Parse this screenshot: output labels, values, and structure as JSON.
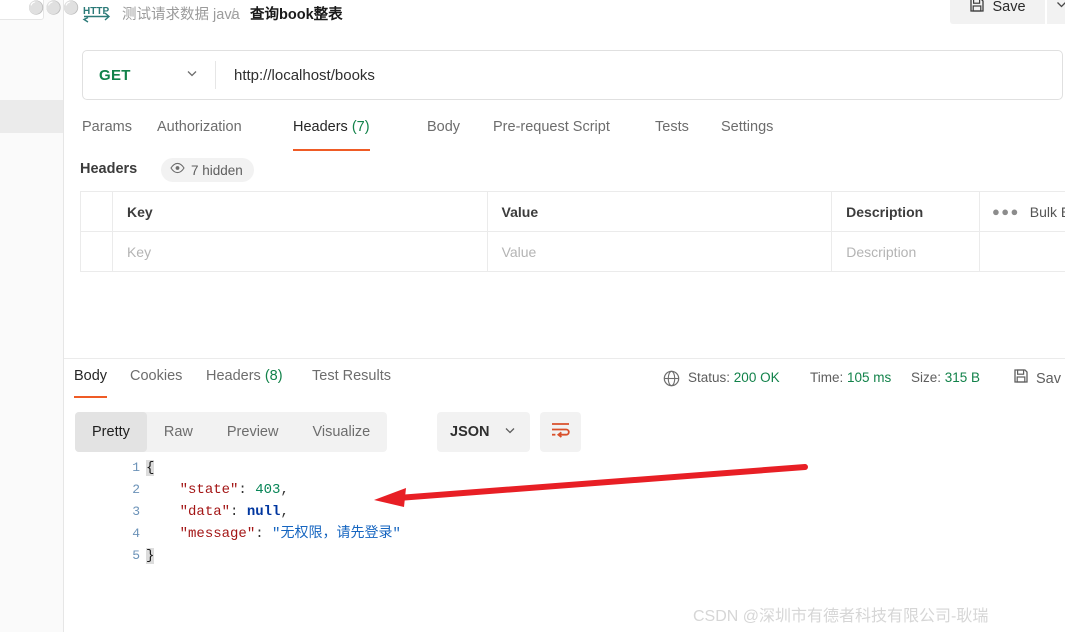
{
  "breadcrumb": {
    "icon": "http-protocol-icon",
    "parent": "测试请求数据 java",
    "separator": "/",
    "current": "查询book整表"
  },
  "header": {
    "save_label": "Save",
    "save_icon": "floppy-disk-icon",
    "caret_icon": "chevron-down-icon"
  },
  "url_bar": {
    "method": "GET",
    "method_caret": "chevron-down-icon",
    "url": "http://localhost/books"
  },
  "request_tabs": [
    {
      "label": "Params",
      "active": false,
      "count": ""
    },
    {
      "label": "Authorization",
      "active": false,
      "count": ""
    },
    {
      "label": "Headers",
      "active": true,
      "count": "(7)"
    },
    {
      "label": "Body",
      "active": false,
      "count": ""
    },
    {
      "label": "Pre-request Script",
      "active": false,
      "count": ""
    },
    {
      "label": "Tests",
      "active": false,
      "count": ""
    },
    {
      "label": "Settings",
      "active": false,
      "count": ""
    }
  ],
  "headers_panel": {
    "title": "Headers",
    "hidden_pill": {
      "icon": "eye-icon",
      "label": "7 hidden"
    },
    "columns": [
      "Key",
      "Value",
      "Description"
    ],
    "placeholders": {
      "key": "Key",
      "value": "Value",
      "description": "Description"
    },
    "more_icon": "ellipsis-icon",
    "bulk_edit_label": "Bulk E"
  },
  "response_tabs": [
    {
      "label": "Body",
      "active": true,
      "count": ""
    },
    {
      "label": "Cookies",
      "active": false,
      "count": ""
    },
    {
      "label": "Headers",
      "active": false,
      "count": "(8)"
    },
    {
      "label": "Test Results",
      "active": false,
      "count": ""
    }
  ],
  "response_meta": {
    "globe_icon": "globe-icon",
    "status_key": "Status:",
    "status_value": "200 OK",
    "time_key": "Time:",
    "time_value": "105 ms",
    "size_key": "Size:",
    "size_value": "315 B",
    "save_icon": "floppy-disk-icon",
    "save_label": "Sav"
  },
  "body_toolbar": {
    "formats": [
      {
        "label": "Pretty",
        "active": true
      },
      {
        "label": "Raw",
        "active": false
      },
      {
        "label": "Preview",
        "active": false
      },
      {
        "label": "Visualize",
        "active": false
      }
    ],
    "language": "JSON",
    "language_caret": "chevron-down-icon",
    "wrap_icon": "word-wrap-icon"
  },
  "code_viewer": {
    "line_numbers": [
      "1",
      "2",
      "3",
      "4",
      "5"
    ],
    "json": {
      "state": 403,
      "data": null,
      "message": "无权限，请先登录"
    }
  },
  "annotation": {
    "arrow_color": "#e81f25",
    "direction": "left"
  },
  "watermark": "CSDN @深圳市有德者科技有限公司-耿瑞",
  "colors": {
    "accent_orange": "#ef5b25",
    "success_green": "#12824a",
    "text_primary": "#262626",
    "text_muted": "#6d6d6d",
    "border": "#ebebeb"
  }
}
